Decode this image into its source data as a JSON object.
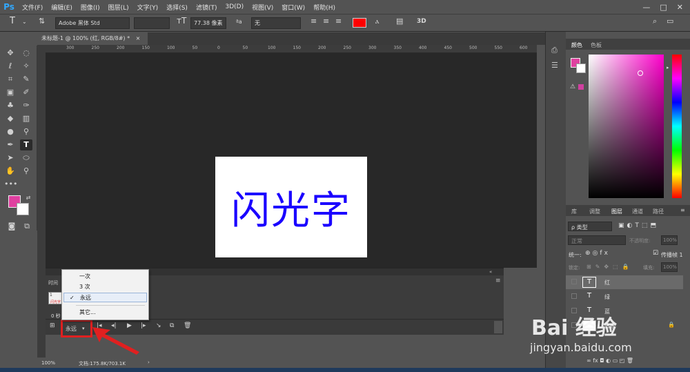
{
  "menubar": {
    "logo": "Ps",
    "items": [
      "文件(F)",
      "编辑(E)",
      "图像(I)",
      "图层(L)",
      "文字(Y)",
      "选择(S)",
      "滤镜(T)",
      "3D(D)",
      "视图(V)",
      "窗口(W)",
      "帮助(H)"
    ],
    "win_buttons": [
      "—",
      "□",
      "✕"
    ]
  },
  "options": {
    "tool_glyph": "T",
    "font_family": "Adobe 黑体 Std",
    "font_size": "77.38 像素",
    "aa_label": "ªa",
    "aa_value": "无",
    "three_d": "3D",
    "text_color": "#ff0000"
  },
  "document": {
    "tab_title": "未标题-1 @ 100% (红, RGB/8#) *",
    "tab_close": "×",
    "canvas_text": "闪光字",
    "text_color": "#1a00ff",
    "ruler_labels": [
      "300",
      "250",
      "200",
      "150",
      "100",
      "50",
      "0",
      "50",
      "100",
      "150",
      "200",
      "250",
      "300",
      "350",
      "400",
      "450",
      "500",
      "550",
      "600"
    ]
  },
  "timeline": {
    "tab_label": "时间",
    "frame_number": "1",
    "frame_time": "0 秒",
    "loop_value": "永远",
    "loop_menu": {
      "options": [
        "一次",
        "3 次",
        "永远"
      ],
      "selected_index": 2,
      "other": "其它..."
    }
  },
  "status": {
    "zoom": "100%",
    "doc_info": "文档:175.8K/703.1K",
    "arrow": "›"
  },
  "color_panel": {
    "tab_active": "颜色",
    "tab_other": "色板",
    "fg_color": "#e040a0"
  },
  "layers_panel": {
    "tabs": [
      "库",
      "调整",
      "图层",
      "通道",
      "路径"
    ],
    "active_tab_index": 2,
    "filter_kind": "ρ 类型",
    "blend_mode": "正常",
    "opacity_label": "不透明度:",
    "opacity_value": "100%",
    "unify_label": "统一:",
    "propagate_label": "传播帧 1",
    "lock_label": "锁定:",
    "fill_label": "填充:",
    "fill_value": "100%",
    "layers": [
      {
        "name": "红",
        "thumb": "T",
        "active": true
      },
      {
        "name": "绿",
        "thumb": "T",
        "active": false
      },
      {
        "name": "蓝",
        "thumb": "T",
        "active": false
      },
      {
        "name": "背景",
        "thumb": "",
        "active": false
      }
    ],
    "bottom_icons": "∞  fx  ◘  ◐  ▭  ◰  🗑"
  },
  "watermark": {
    "logo": "Bai 经验",
    "url": "jingyan.baidu.com"
  }
}
